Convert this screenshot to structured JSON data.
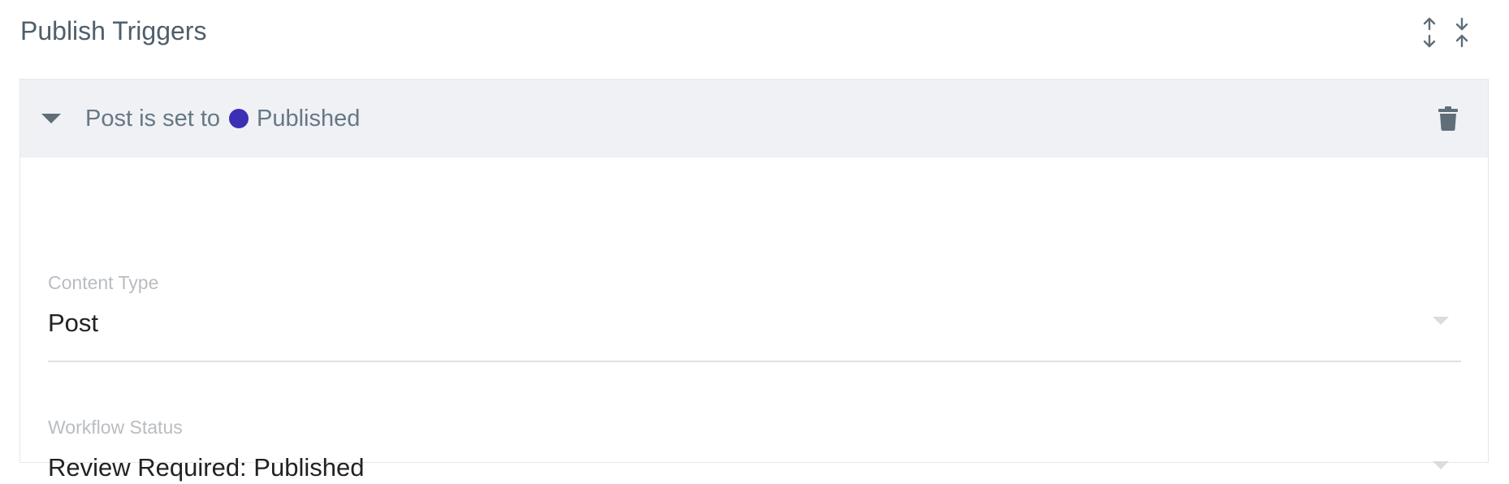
{
  "section": {
    "title": "Publish Triggers"
  },
  "header_actions": {
    "expand_all_icon": "expand-vertical-icon",
    "collapse_all_icon": "collapse-vertical-icon"
  },
  "trigger": {
    "summary_prefix": "Post is set to",
    "status_label": "Published",
    "status_color": "#3b2fb5",
    "expanded": true,
    "delete_icon": "trash-icon"
  },
  "fields": [
    {
      "label": "Content Type",
      "value": "Post"
    },
    {
      "label": "Workflow Status",
      "value": "Review Required: Published"
    }
  ],
  "colors": {
    "header_bg": "#eff1f5",
    "title_text": "#4f5f6b",
    "summary_text": "#667884",
    "icon": "#5f6e79",
    "label_text": "#b9bdc1",
    "value_text": "#222222"
  }
}
